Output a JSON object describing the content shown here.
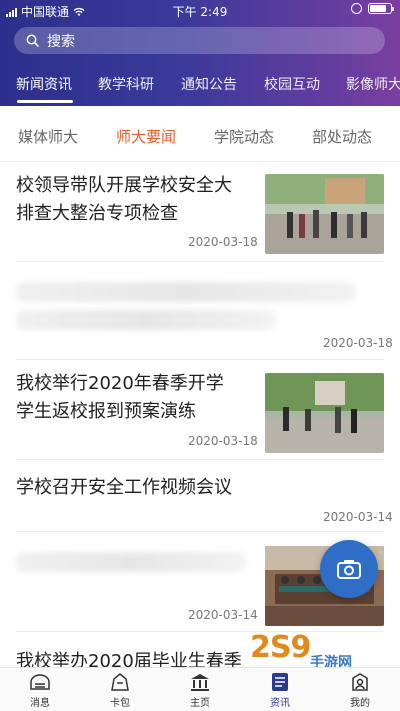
{
  "status_bar": {
    "carrier": "中国联通",
    "time": "下午 2:49",
    "battery_level": 0.8
  },
  "search": {
    "placeholder": "搜索",
    "icon": "search-icon"
  },
  "top_tabs": [
    {
      "label": "新闻资讯",
      "active": true
    },
    {
      "label": "教学科研",
      "active": false
    },
    {
      "label": "通知公告",
      "active": false
    },
    {
      "label": "校园互动",
      "active": false
    },
    {
      "label": "影像师大",
      "active": false
    }
  ],
  "sub_tabs": [
    {
      "label": "媒体师大",
      "active": false
    },
    {
      "label": "师大要闻",
      "active": true
    },
    {
      "label": "学院动态",
      "active": false
    },
    {
      "label": "部处动态",
      "active": false
    }
  ],
  "feed": [
    {
      "title_line1": "校领导带队开展学校安全大",
      "title_line2": "排查大整治专项检查",
      "date": "2020-03-18",
      "has_image": true
    },
    {
      "title_line1": "",
      "title_line2": "",
      "date": "2020-03-18",
      "has_image": false
    },
    {
      "title_line1": "我校举行2020年春季开学",
      "title_line2": "学生返校报到预案演练",
      "date": "2020-03-18",
      "has_image": true
    },
    {
      "title_line1": "学校召开安全工作视频会议",
      "title_line2": "",
      "date": "2020-03-14",
      "has_image": false
    },
    {
      "title_line1": "",
      "title_line2": "",
      "date": "2020-03-14",
      "has_image": true
    },
    {
      "title_line1": "我校举办2020届毕业生春季",
      "title_line2": "",
      "date": "",
      "has_image": false
    }
  ],
  "watermark": {
    "main": "2S9",
    "sub": "手游网"
  },
  "bottom_nav": [
    {
      "label": "消息",
      "icon": "message-icon",
      "active": false
    },
    {
      "label": "卡包",
      "icon": "card-bag-icon",
      "active": false
    },
    {
      "label": "主页",
      "icon": "home-icon",
      "active": false
    },
    {
      "label": "资讯",
      "icon": "news-icon",
      "active": true
    },
    {
      "label": "我的",
      "icon": "profile-icon",
      "active": false
    }
  ],
  "colors": {
    "header_start": "#2d2f8c",
    "header_end": "#7a3fa0",
    "accent": "#e35d2f",
    "fab": "#2f6ec6",
    "nav_active": "#2d3a8c"
  }
}
